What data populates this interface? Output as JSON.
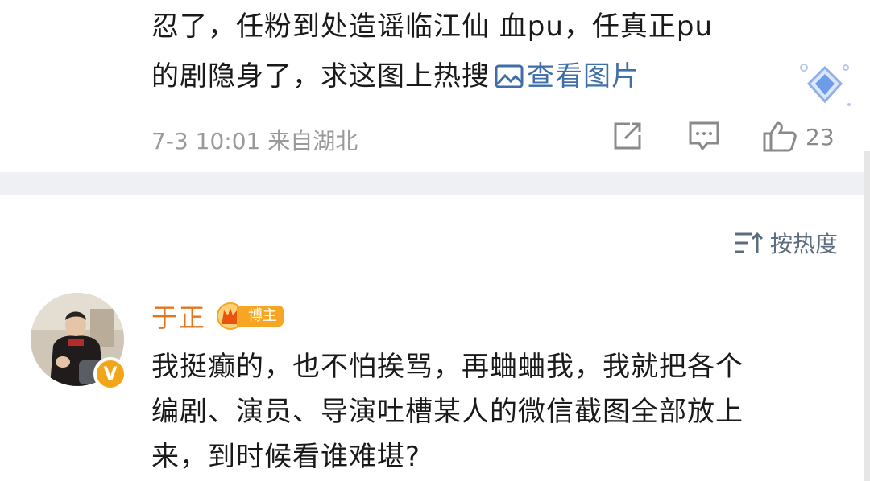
{
  "previous_comment": {
    "lines": [
      "忍了，任粉到处造谣临江仙 血pu，任真正pu",
      "的剧隐身了，求这图上热搜"
    ],
    "view_image_label": "查看图片",
    "timestamp": "7-3 10:01",
    "location": "来自湖北",
    "like_count": "23"
  },
  "sort": {
    "label": "按热度"
  },
  "main_comment": {
    "author": "于正",
    "badge": "博主",
    "verified_mark": "V",
    "lines": [
      "我挺癫的，也不怕挨骂，再蛐蛐我，我就把各个",
      "编剧、演员、导演吐槽某人的微信截图全部放上",
      "来，到时候看谁难堪?"
    ]
  },
  "colors": {
    "link_blue": "#3f6ea8",
    "author_orange": "#e2761f",
    "badge_orange": "#f6a623",
    "meta_gray": "#9a9a9a",
    "divider_gray": "#eff0f3"
  },
  "icons": {
    "view_image": "image-icon",
    "share": "share-icon",
    "reply": "comment-icon",
    "like": "thumbs-up-icon",
    "sort": "sort-icon",
    "badge": "crown-icon",
    "verified": "verified-v-icon"
  }
}
